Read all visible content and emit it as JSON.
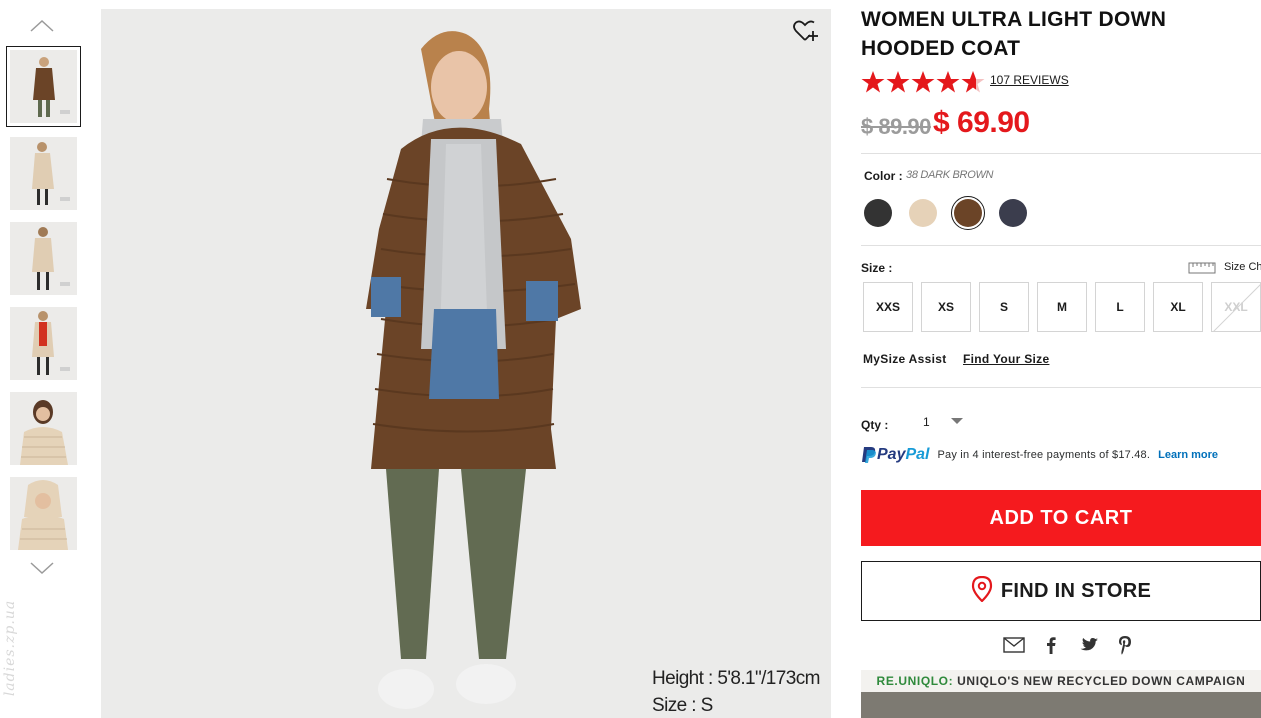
{
  "gallery": {
    "thumbnails": [
      {
        "alt": "brown coat front",
        "selected": true
      },
      {
        "alt": "beige coat side",
        "selected": false
      },
      {
        "alt": "beige coat back",
        "selected": false
      },
      {
        "alt": "beige coat red scarf",
        "selected": false
      },
      {
        "alt": "beige coat closeup",
        "selected": false
      },
      {
        "alt": "beige coat hood",
        "selected": false
      }
    ],
    "watermark": "ladies.zp.ua"
  },
  "main_image": {
    "model_height": "Height : 5'8.1\"/173cm",
    "model_size": "Size : S"
  },
  "product": {
    "title": "WOMEN ULTRA LIGHT DOWN HOODED COAT",
    "rating": 4.5,
    "reviews_label": "107 REVIEWS",
    "price_original": "$ 89.90",
    "price_sale": "$ 69.90"
  },
  "color": {
    "label": "Color :",
    "selected_name": "38 DARK BROWN",
    "swatches": [
      {
        "name": "black",
        "hex": "#333333"
      },
      {
        "name": "beige",
        "hex": "#e6d2b8"
      },
      {
        "name": "dark-brown",
        "hex": "#6b4427"
      },
      {
        "name": "navy",
        "hex": "#3b3d4d"
      }
    ],
    "selected_index": 2
  },
  "size": {
    "label": "Size :",
    "chart_label": "Size Chart",
    "options": [
      "XXS",
      "XS",
      "S",
      "M",
      "L",
      "XL",
      "XXL"
    ],
    "disabled": [
      "XXL"
    ]
  },
  "mysize": {
    "label": "MySize Assist",
    "link": "Find Your Size"
  },
  "qty": {
    "label": "Qty :",
    "value": "1"
  },
  "paypal": {
    "logo_part1": "Pay",
    "logo_part2": "Pal",
    "text": "Pay in 4 interest-free payments of $17.48.",
    "learn_more": "Learn more"
  },
  "actions": {
    "add_to_cart": "ADD TO CART",
    "find_in_store": "FIND IN STORE"
  },
  "share_icons": [
    "mail-icon",
    "facebook-icon",
    "twitter-icon",
    "pinterest-icon"
  ],
  "campaign": {
    "brand": "RE.UNIQLO:",
    "title": "UNIQLO'S NEW RECYCLED DOWN CAMPAIGN"
  },
  "colors": {
    "accent_red": "#e4181c",
    "cart_red": "#f51a1e",
    "campaign_green": "#2f8a3c"
  }
}
